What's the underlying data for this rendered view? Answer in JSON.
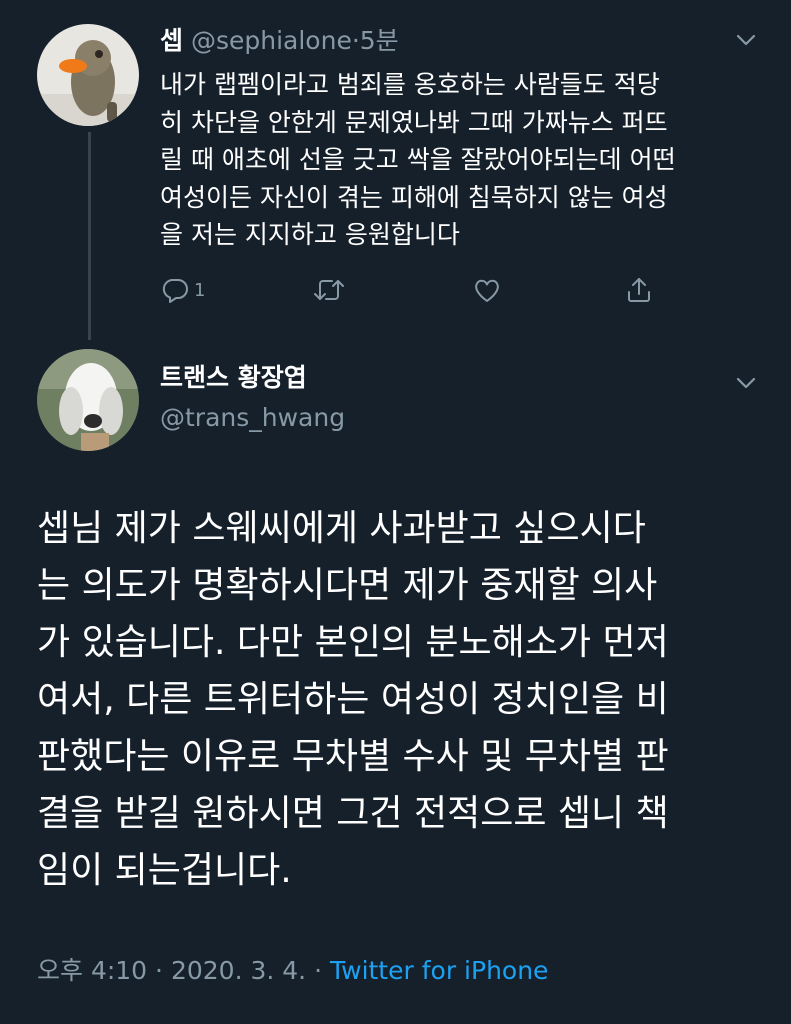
{
  "reply_tweet": {
    "display_name": "셉",
    "handle": "@sephialone",
    "separator": "·",
    "time_ago": "5분",
    "lines": [
      "내가 랩펨이라고 범죄를 옹호하는 사람들도 적당",
      "히 차단을 안한게 문제였나봐 그때 가짜뉴스 퍼뜨",
      "릴 때 애초에 선을 긋고 싹을 잘랐어야되는데 어떤",
      "여성이든 자신이 겪는 피해에 침묵하지 않는 여성",
      "을 저는 지지하고 응원합니다"
    ],
    "reply_count": "1",
    "avatar_icon": "duck-plush-avatar"
  },
  "main_tweet": {
    "display_name": "트랜스 황장엽",
    "handle": "@trans_hwang",
    "lines": [
      "셉님 제가 스웨씨에게 사과받고 싶으시다",
      "는 의도가 명확하시다면 제가 중재할 의사",
      "가 있습니다. 다만 본인의 분노해소가 먼저",
      "여서, 다른 트위터하는 여성이 정치인을 비",
      "판했다는 이유로 무차별 수사 및 무차별 판",
      "결을 받길 원하시면 그건 전적으로 셉니 책",
      "임이 되는겁니다."
    ],
    "avatar_icon": "dog-avatar"
  },
  "meta": {
    "time": "오후 4:10",
    "sep1": "·",
    "date": "2020. 3. 4.",
    "sep2": "·",
    "source": "Twitter for iPhone"
  },
  "icons": {
    "reply": "reply-icon",
    "retweet": "retweet-icon",
    "like": "heart-icon",
    "share": "share-icon",
    "more": "chevron-down-icon"
  },
  "colors": {
    "background": "#15202b",
    "text": "#ffffff",
    "muted": "#8899a6",
    "link": "#1da1f2",
    "thread_line": "#38444d"
  }
}
